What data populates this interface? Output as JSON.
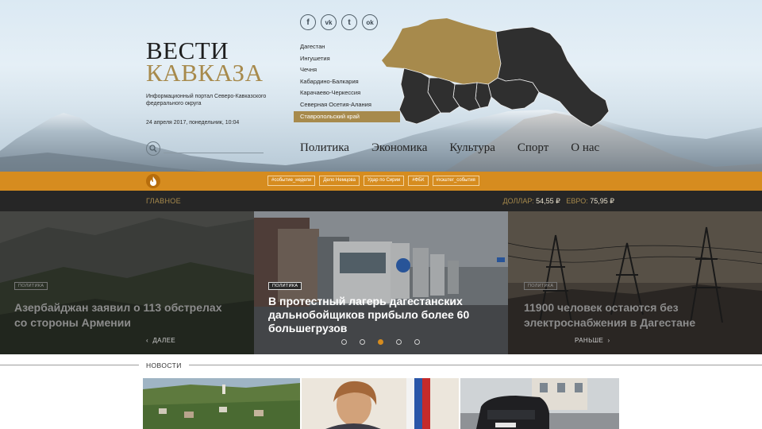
{
  "logo": {
    "line1": "ВЕСТИ",
    "line2": "КАВКАЗА"
  },
  "tagline": "Информационный портал Северо-Кавказского федерального округа",
  "date": "24 апреля 2017, понедельник, 10:04",
  "search": {
    "placeholder": ""
  },
  "socials": [
    {
      "name": "facebook",
      "glyph": "f"
    },
    {
      "name": "vkontakte",
      "glyph": "vk"
    },
    {
      "name": "twitter",
      "glyph": "t"
    },
    {
      "name": "odnoklassniki",
      "glyph": "ok"
    }
  ],
  "regions": [
    {
      "label": "Дагестан"
    },
    {
      "label": "Ингушетия"
    },
    {
      "label": "Чечня"
    },
    {
      "label": "Кабардино-Балкария"
    },
    {
      "label": "Карачаево-Черкессия"
    },
    {
      "label": "Северная Осетия-Алания"
    },
    {
      "label": "Ставропольский край",
      "active": true
    }
  ],
  "nav": [
    {
      "label": "Политика"
    },
    {
      "label": "Экономика"
    },
    {
      "label": "Культура"
    },
    {
      "label": "Спорт"
    },
    {
      "label": "О нас"
    }
  ],
  "tags": [
    "#событие_недели",
    "Дело Немцова",
    "Удар по Сирии",
    "#ФБК",
    "#хэштег_события"
  ],
  "main_label": "ГЛАВНОЕ",
  "rates": {
    "usd_label": "ДОЛЛАР:",
    "usd_value": "54,55 ₽",
    "eur_label": "ЕВРО:",
    "eur_value": "75,95 ₽"
  },
  "slides": {
    "left": {
      "category": "ПОЛИТИКА",
      "title": "Азербайджан заявил о 113 обстрелах со стороны Армении"
    },
    "center": {
      "category": "ПОЛИТИКА",
      "title": "В протестный лагерь дагестанских дальнобойщиков прибыло более 60 большегрузов"
    },
    "right": {
      "category": "ПОЛИТИКА",
      "title": "11900 человек остаются без электроснабжения в Дагестане"
    }
  },
  "slider_controls": {
    "prev": "ДАЛЕЕ",
    "next": "РАНЬШЕ",
    "dots": 5,
    "active_dot": 3
  },
  "news_label": "НОВОСТИ",
  "colors": {
    "accent_gold": "#a78a4c",
    "accent_orange": "#d68c1f",
    "dark_bar": "#262626",
    "map_dark": "#2f2f2f"
  },
  "icons": {
    "search": "search-icon",
    "fire": "fire-icon",
    "prev": "chevron-left-icon",
    "next": "chevron-right-icon"
  }
}
